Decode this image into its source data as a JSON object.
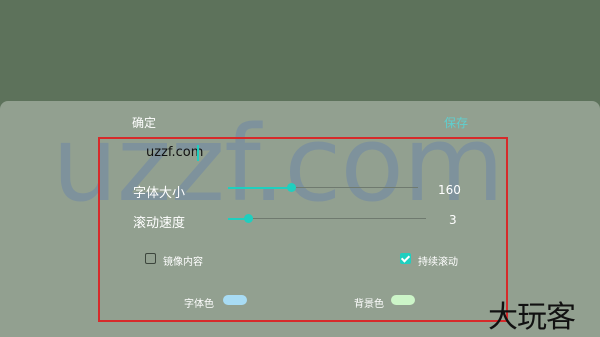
{
  "dialog": {
    "title": "确定",
    "save_label": "保存"
  },
  "watermark": "uzzf.com",
  "text_input": {
    "value": "uzzf.com"
  },
  "font_size": {
    "label": "字体大小",
    "value": "160",
    "level": 0.33
  },
  "scroll_speed": {
    "label": "滚动速度",
    "value": "3",
    "level": 0.1
  },
  "options": {
    "mirror": {
      "label": "镜像内容",
      "checked": false
    },
    "continuous": {
      "label": "持续滚动",
      "checked": true
    }
  },
  "colors": {
    "font_color_label": "字体色",
    "font_color": "#a8dcf4",
    "bg_color_label": "背景色",
    "bg_color": "#ccf5c8",
    "accent": "#1fcfbf"
  },
  "logo": "大玩客"
}
